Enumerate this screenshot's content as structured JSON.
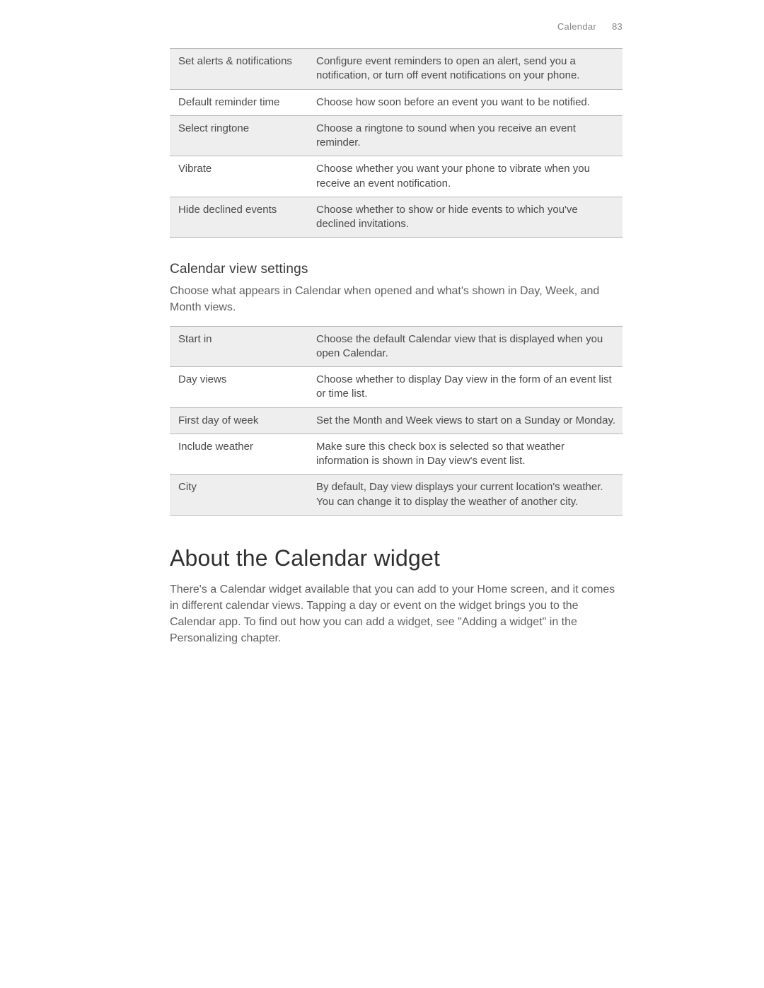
{
  "header": {
    "section": "Calendar",
    "page_number": "83"
  },
  "tables": {
    "reminder_settings": {
      "rows": [
        {
          "label": "Set alerts & notifications",
          "desc": "Configure event reminders to open an alert, send you a notification, or turn off event notifications on your phone."
        },
        {
          "label": "Default reminder time",
          "desc": "Choose how soon before an event you want to be notified."
        },
        {
          "label": "Select ringtone",
          "desc": "Choose a ringtone to sound when you receive an event reminder."
        },
        {
          "label": "Vibrate",
          "desc": "Choose whether you want your phone to vibrate when you receive an event notification."
        },
        {
          "label": "Hide declined events",
          "desc": "Choose whether to show or hide events to which you've declined invitations."
        }
      ]
    },
    "view_settings": {
      "rows": [
        {
          "label": "Start in",
          "desc": "Choose the default Calendar view that is displayed when you open Calendar."
        },
        {
          "label": "Day views",
          "desc": "Choose whether to display Day view in the form of an event list or time list."
        },
        {
          "label": "First day of week",
          "desc": "Set the Month and Week views to start on a Sunday or Monday."
        },
        {
          "label": "Include weather",
          "desc": "Make sure this check box is selected so that weather information is shown in Day view's event list."
        },
        {
          "label": "City",
          "desc": "By default, Day view displays your current location's weather. You can change it to display the weather of another city."
        }
      ]
    }
  },
  "sections": {
    "view_settings_heading": "Calendar view settings",
    "view_settings_intro": "Choose what appears in Calendar when opened and what's shown in Day, Week, and Month views.",
    "widget_heading": "About the Calendar widget",
    "widget_body": "There's a Calendar widget available that you can add to your Home screen, and it comes in different calendar views. Tapping a day or event on the widget brings you to the Calendar app. To find out how you can add a widget, see \"Adding a widget\" in the Personalizing chapter."
  }
}
